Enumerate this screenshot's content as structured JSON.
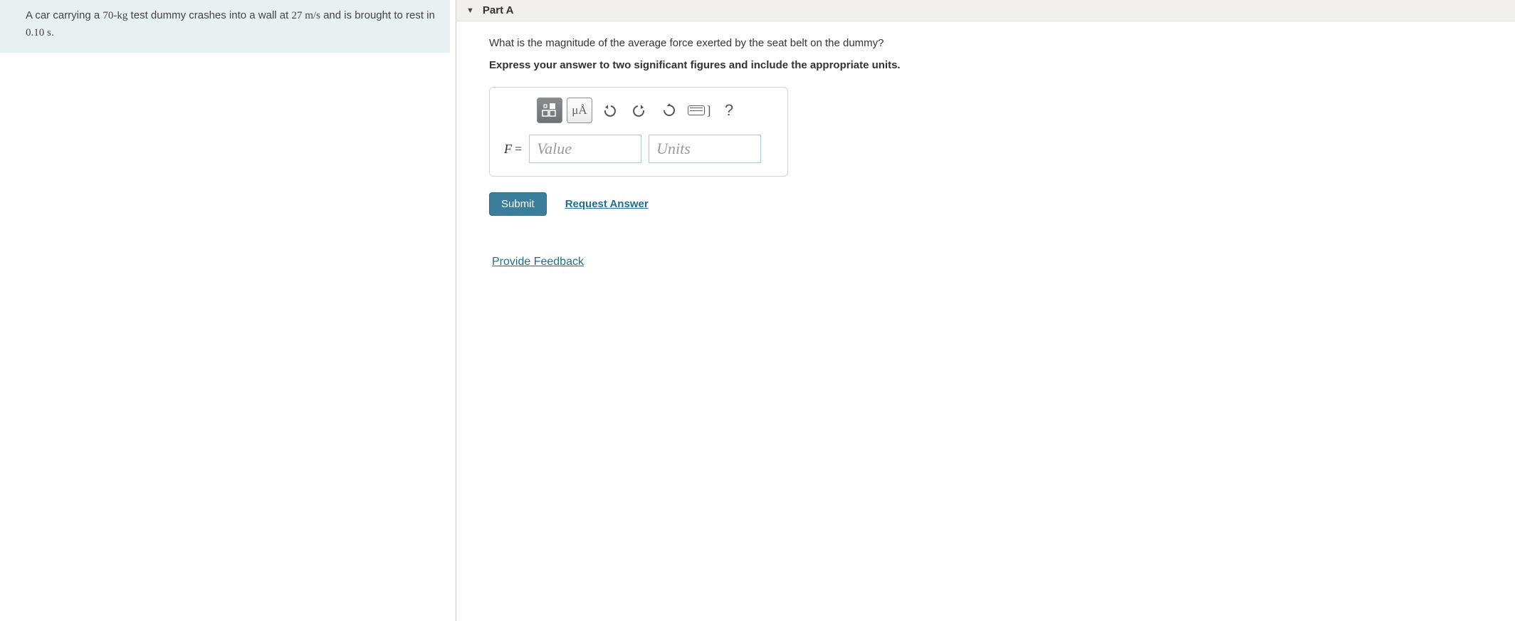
{
  "problem": {
    "prefix": "A car carrying a ",
    "mass": "70-kg",
    "mid1": " test dummy crashes into a wall at ",
    "speed": "27 m/s",
    "mid2": " and is brought to rest in ",
    "time": "0.10 s",
    "suffix": "."
  },
  "part": {
    "title": "Part A",
    "question": "What is the magnitude of the average force exerted by the seat belt on the dummy?",
    "instruction": "Express your answer to two significant figures and include the appropriate units."
  },
  "answer": {
    "variable": "F",
    "equals": "=",
    "value_placeholder": "Value",
    "units_placeholder": "Units"
  },
  "toolbar": {
    "units_symbol": "μÅ",
    "keyboard_bracket": "]"
  },
  "actions": {
    "submit": "Submit",
    "request_answer": "Request Answer",
    "provide_feedback": "Provide Feedback"
  }
}
